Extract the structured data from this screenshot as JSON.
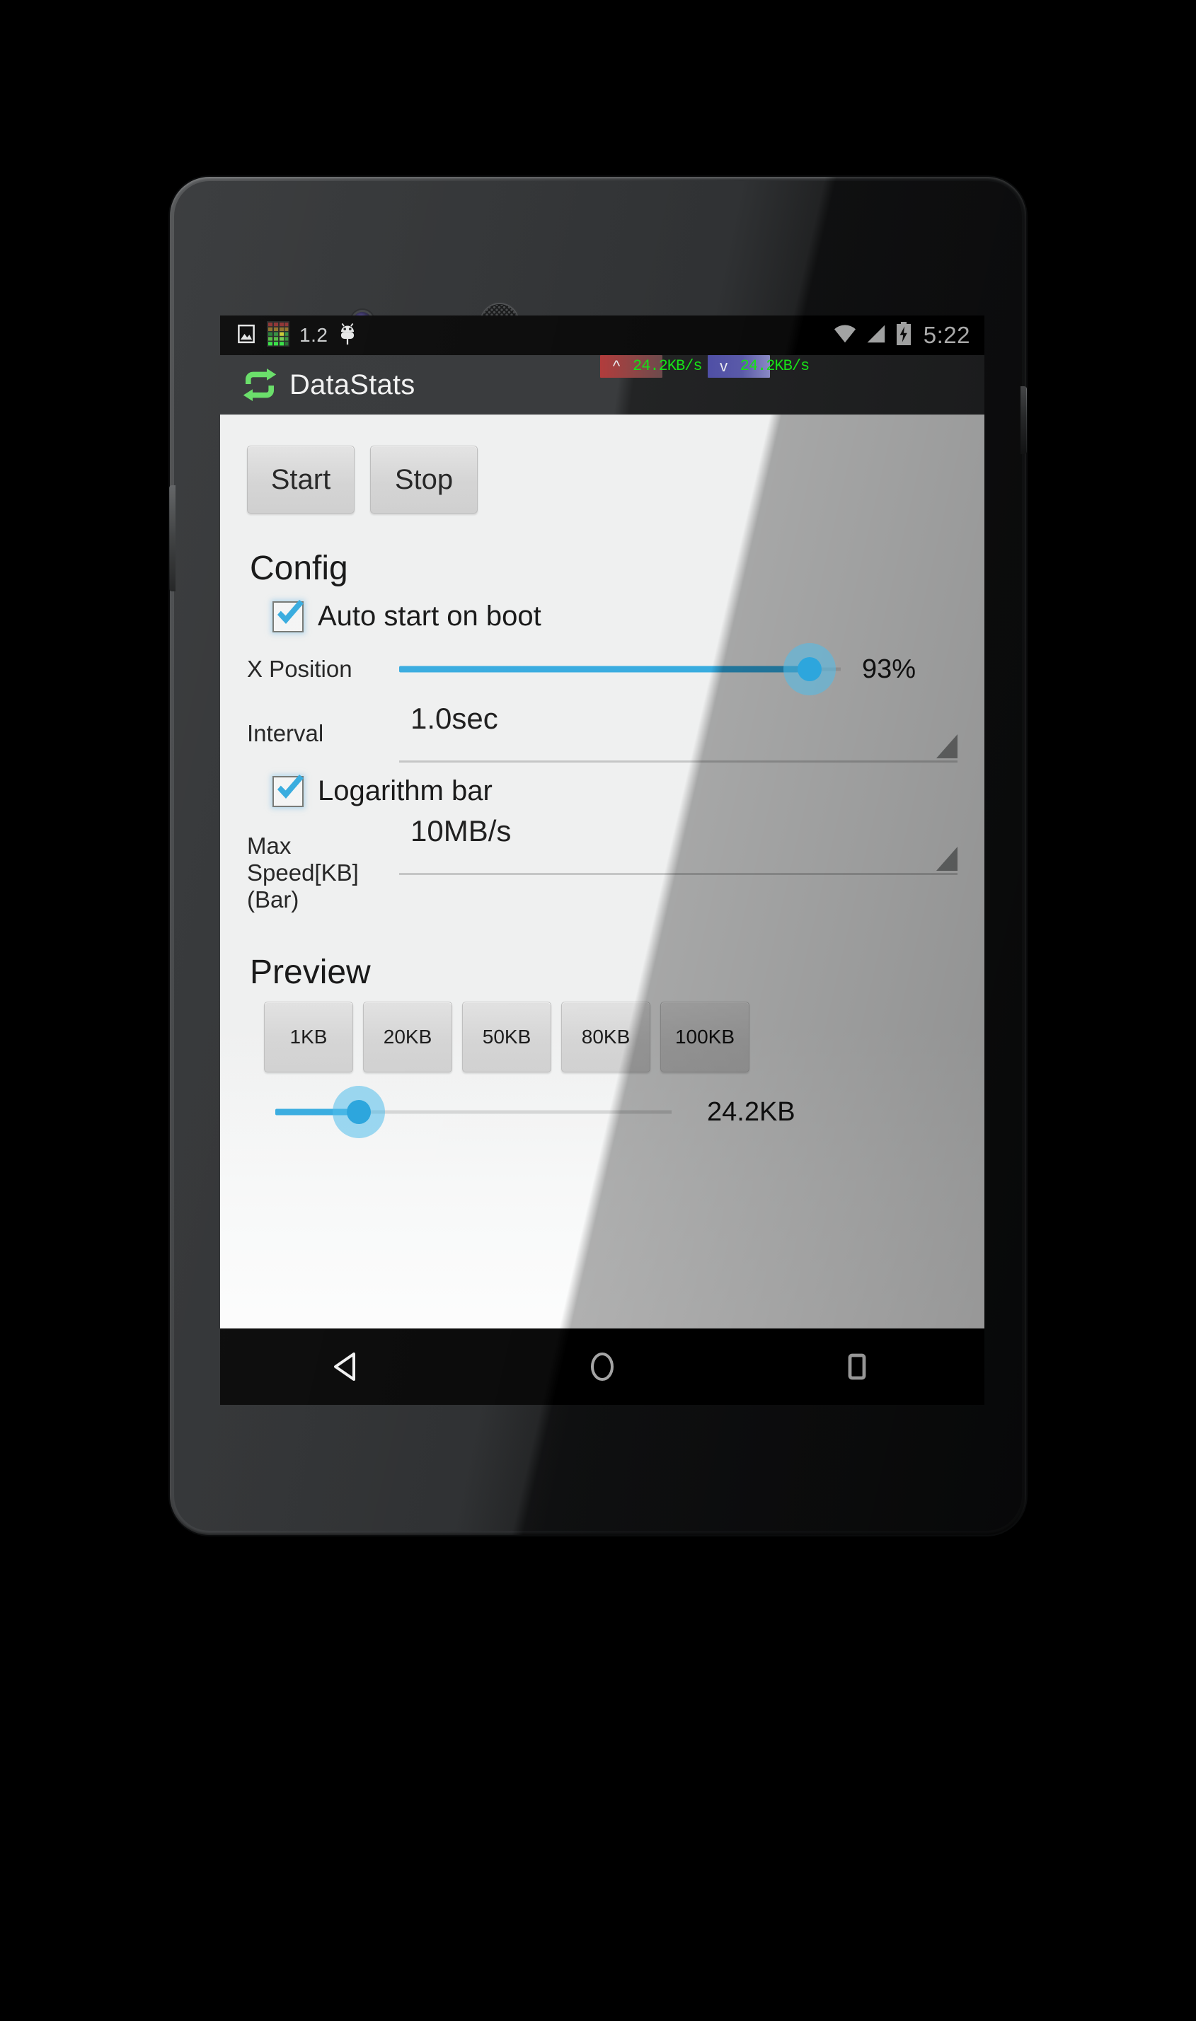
{
  "device": {
    "frame": "nexus-phone",
    "camera": "front-camera",
    "speaker": "earpiece-speaker"
  },
  "status_bar": {
    "left_icons": [
      "image-icon",
      "data-matrix-icon",
      "android-bug-icon"
    ],
    "version_text": "1.2",
    "right_icons": [
      "wifi-icon",
      "cellular-signal-icon",
      "battery-charging-icon"
    ],
    "clock": "5:22"
  },
  "speed_overlay": {
    "upload": {
      "arrow": "^",
      "value": "24.2KB/s",
      "bar_color": "#b23c3c",
      "text_color": "#17e017"
    },
    "download": {
      "arrow": "v",
      "value": "24.2KB/s",
      "bar_color": "#4f4fa6",
      "text_color": "#17e017"
    }
  },
  "action_bar": {
    "icon": "sync-refresh-icon",
    "icon_color": "#6bdf6b",
    "title": "DataStats"
  },
  "controls": {
    "start_label": "Start",
    "stop_label": "Stop"
  },
  "config": {
    "title": "Config",
    "auto_start": {
      "label": "Auto start on boot",
      "checked": true
    },
    "x_position": {
      "label": "X Position",
      "value_text": "93%",
      "percent": 93
    },
    "interval": {
      "label": "Interval",
      "value": "1.0sec"
    },
    "logarithm_bar": {
      "label": "Logarithm bar",
      "checked": true
    },
    "max_speed": {
      "label_line1": "Max Speed[KB]",
      "label_line2": "(Bar)",
      "value": "10MB/s"
    }
  },
  "preview": {
    "title": "Preview",
    "presets": [
      {
        "label": "1KB"
      },
      {
        "label": "20KB"
      },
      {
        "label": "50KB"
      },
      {
        "label": "80KB"
      },
      {
        "label": "100KB"
      }
    ],
    "slider": {
      "value_text": "24.2KB",
      "percent": 21
    }
  },
  "nav_bar": {
    "back": "back-triangle-icon",
    "home": "home-circle-icon",
    "recents": "recents-square-icon"
  },
  "theme": {
    "accent": "#2da6dd",
    "accent_light": "#7fd2ee",
    "screen_bg": "#eeefef",
    "action_bar_bg": "#3a3c3e"
  }
}
